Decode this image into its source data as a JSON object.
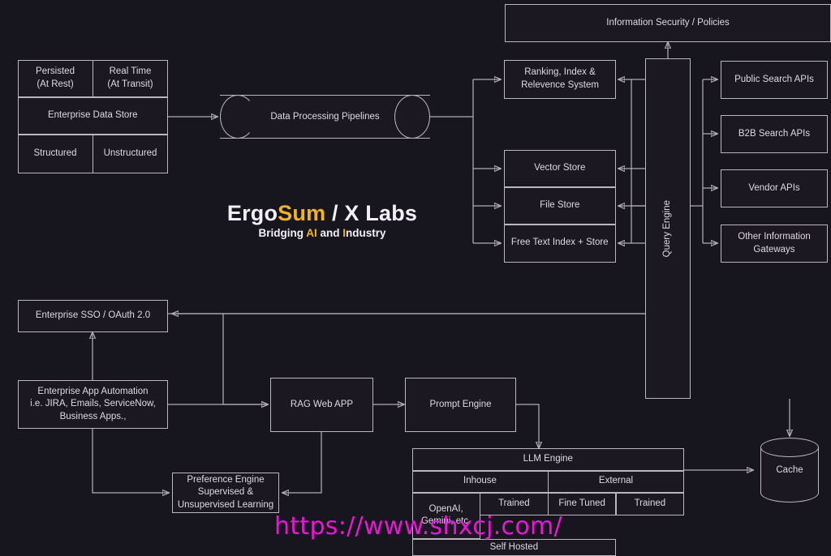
{
  "brand": {
    "name_part1": "Ergo",
    "name_part2": "Sum",
    "name_part3": " / X Labs",
    "tagline_part1": "Bridging ",
    "tagline_part2": "AI",
    "tagline_part3": " and ",
    "tagline_part4": "I",
    "tagline_part5": "ndustry",
    "accent_color": "#f0b323"
  },
  "diagram": {
    "data_store": {
      "persisted": "Persisted\n(At Rest)",
      "persisted_l1": "Persisted",
      "persisted_l2": "(At Rest)",
      "realtime_l1": "Real Time",
      "realtime_l2": "(At Transit)",
      "title": "Enterprise Data Store",
      "structured": "Structured",
      "unstructured": "Unstructured"
    },
    "pipelines": "Data Processing Pipelines",
    "ranking_l1": "Ranking, Index &",
    "ranking_l2": "Relevence System",
    "vector_store": "Vector Store",
    "file_store": "File Store",
    "free_text": "Free Text Index + Store",
    "query_engine": "Query Engine",
    "infosec": "Information Security / Policies",
    "apis": [
      "Public Search APIs",
      "B2B Search APIs",
      "Vendor APIs",
      "Other Information\nGateways"
    ],
    "api_other_l1": "Other Information",
    "api_other_l2": "Gateways",
    "sso": "Enterprise SSO / OAuth 2.0",
    "app_automation_l1": "Enterprise App Automation",
    "app_automation_l2": "i.e. JIRA, Emails, ServiceNow,",
    "app_automation_l3": "Business Apps.,",
    "rag_web_app": "RAG Web APP",
    "prompt_engine": "Prompt Engine",
    "preference_l1": "Preference Engine",
    "preference_l2": "Supervised &",
    "preference_l3": "Unsupervised Learning",
    "cache": "Cache",
    "llm": {
      "title": "LLM Engine",
      "inhouse": "Inhouse",
      "external": "External",
      "inhouse_trained": "Trained",
      "inhouse_finetuned": "Fine Tuned",
      "external_trained": "Trained",
      "external_vendors_l1": "OpenAI,",
      "external_vendors_l2": "Gemini, etc.",
      "self_hosted": "Self Hosted"
    }
  },
  "watermark": "https://www.shxcj.com/"
}
